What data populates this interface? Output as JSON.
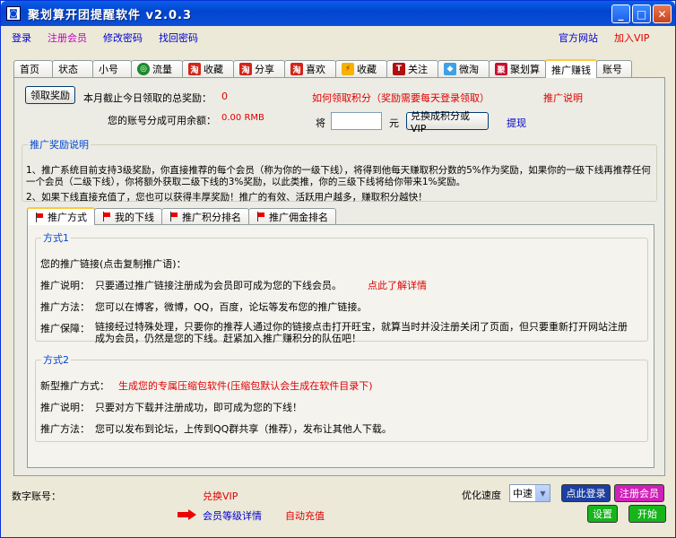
{
  "window": {
    "title": "聚划算开团提醒软件  v2.0.3"
  },
  "menu": {
    "login": "登录",
    "register": "注册会员",
    "change_password": "修改密码",
    "recover_password": "找回密码",
    "official_site": "官方网站",
    "join_vip": "加入VIP"
  },
  "tabs": [
    {
      "label": "首页"
    },
    {
      "label": "状态"
    },
    {
      "label": "小号"
    },
    {
      "label": "流量"
    },
    {
      "label": "收藏"
    },
    {
      "label": "分享"
    },
    {
      "label": "喜欢"
    },
    {
      "label": "收藏"
    },
    {
      "label": "关注"
    },
    {
      "label": "微淘"
    },
    {
      "label": "聚划算"
    },
    {
      "label": "推广赚钱"
    },
    {
      "label": "账号"
    }
  ],
  "reward": {
    "claim_button": "领取奖励",
    "month_total_label": "本月截止今日领取的总奖励：",
    "month_total_value": "0",
    "how_to_link": "如何领取积分（奖励需要每天登录领取）",
    "promo_help": "推广说明",
    "balance_label": "您的账号分成可用余额：",
    "balance_value": "0.00 RMB",
    "convert_prefix": "将",
    "convert_unit": "元",
    "convert_button": "兑换成积分或VIP",
    "withdraw": "提现"
  },
  "explain": {
    "legend": "推广奖励说明",
    "p1": "1、推广系统目前支持3级奖励，你直接推荐的每个会员（称为你的一级下线），将得到他每天赚取积分数的5%作为奖励，如果你的一级下线再推荐任何一个会员（二级下线），你将额外获取二级下线的3%奖励，以此类推，你的三级下线将给你带来1%奖励。",
    "p2": "2、如果下线直接充值了，您也可以获得丰厚奖励！推广的有效、活跃用户越多，赚取积分越快！"
  },
  "subtabs": [
    {
      "label": "推广方式"
    },
    {
      "label": "我的下线"
    },
    {
      "label": "推广积分排名"
    },
    {
      "label": "推广佣金排名"
    }
  ],
  "method1": {
    "legend": "方式1",
    "link_label": "您的推广链接(点击复制推广语)：",
    "desc_label": "推广说明：",
    "desc_text": "只要通过推广链接注册成为会员即可成为您的下线会员。",
    "desc_link": "点此了解详情",
    "method_label": "推广方法：",
    "method_text": "您可以在博客，微博，QQ，百度，论坛等发布您的推广链接。",
    "guarantee_label": "推广保障：",
    "guarantee_text": "链接经过特殊处理，只要你的推荐人通过你的链接点击打开旺宝，就算当时并没注册关闭了页面，但只要重新打开网站注册成为会员，仍然是您的下线。赶紧加入推广赚积分的队伍吧！"
  },
  "method2": {
    "legend": "方式2",
    "new_label": "新型推广方式：",
    "new_text": "生成您的专属压缩包软件(压缩包默认会生成在软件目录下)",
    "desc_label": "推广说明：",
    "desc_text": "只要对方下载并注册成功，即可成为您的下线！",
    "method_label": "推广方法：",
    "method_text": "您可以发布到论坛，上传到QQ群共享（推荐），发布让其他人下载。"
  },
  "bottom": {
    "digital_account_label": "数字账号：",
    "exchange_vip": "兑换VIP",
    "member_levels": "会员等级详情",
    "auto_recharge": "自动充值",
    "speed_label": "优化速度",
    "speed_value": "中速",
    "login_btn": "点此登录",
    "register_btn": "注册会员",
    "settings_btn": "设置",
    "start_btn": "开始"
  },
  "colors": {
    "accent_blue": "#0046d5",
    "link_red": "#e00000",
    "tab_highlight": "#ffc83c"
  }
}
